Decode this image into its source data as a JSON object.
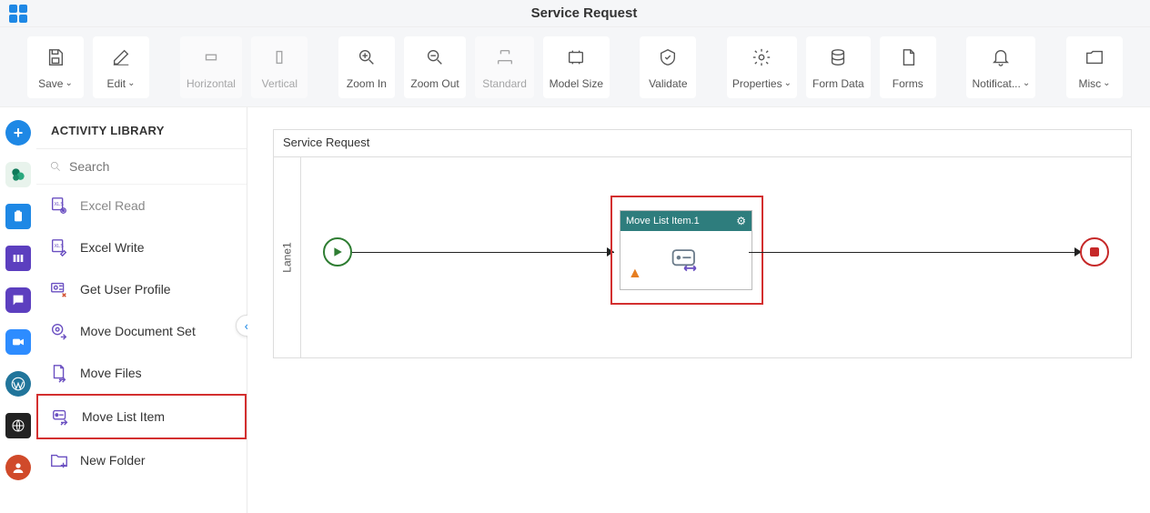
{
  "header": {
    "title": "Service Request"
  },
  "toolbar": {
    "save": "Save",
    "edit": "Edit",
    "horizontal": "Horizontal",
    "vertical": "Vertical",
    "zoom_in": "Zoom In",
    "zoom_out": "Zoom Out",
    "standard": "Standard",
    "model_size": "Model Size",
    "validate": "Validate",
    "properties": "Properties",
    "form_data": "Form Data",
    "forms": "Forms",
    "notification": "Notificat...",
    "misc": "Misc"
  },
  "sidebar": {
    "title": "ACTIVITY LIBRARY",
    "search_placeholder": "Search",
    "items": [
      {
        "label": "Excel Read"
      },
      {
        "label": "Excel Write"
      },
      {
        "label": "Get User Profile"
      },
      {
        "label": "Move Document Set"
      },
      {
        "label": "Move Files"
      },
      {
        "label": "Move List Item"
      },
      {
        "label": "New Folder"
      }
    ]
  },
  "canvas": {
    "title": "Service Request",
    "lane": "Lane1",
    "node_title": "Move List Item.1"
  }
}
